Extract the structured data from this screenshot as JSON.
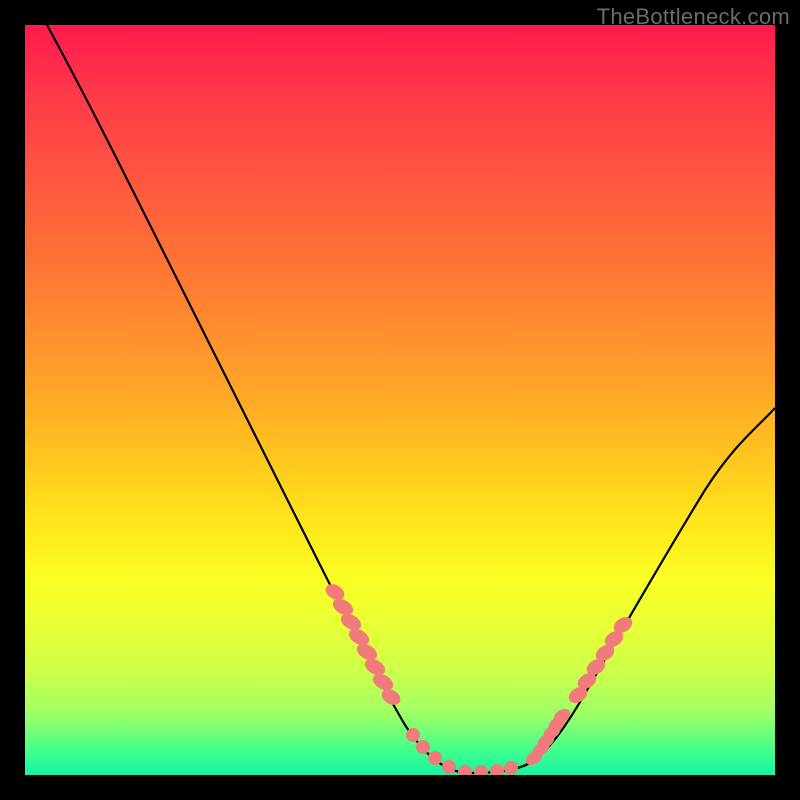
{
  "watermark": "TheBottleneck.com",
  "chart_data": {
    "type": "line",
    "title": "",
    "xlabel": "",
    "ylabel": "",
    "xlim": [
      0,
      100
    ],
    "ylim": [
      0,
      100
    ],
    "grid": false,
    "series": [
      {
        "name": "curve",
        "x": [
          3,
          8,
          12,
          18,
          24,
          30,
          36,
          41,
          47,
          50,
          53,
          56,
          60,
          63,
          66,
          68,
          71,
          74,
          78,
          82,
          86,
          90,
          94,
          100
        ],
        "y": [
          100,
          90,
          82,
          70,
          58,
          46,
          34,
          24,
          12,
          7,
          3,
          1,
          0,
          0,
          0,
          1,
          3,
          6,
          11,
          17,
          24,
          31,
          38,
          49
        ]
      }
    ],
    "highlights": [
      {
        "name": "left-cluster",
        "x_range": [
          41,
          49
        ],
        "y_range": [
          7,
          24
        ]
      },
      {
        "name": "valley-cluster",
        "x_range": [
          52,
          66
        ],
        "y_range": [
          0,
          3
        ]
      },
      {
        "name": "right-dense",
        "x_range": [
          67,
          72
        ],
        "y_range": [
          1,
          7
        ]
      },
      {
        "name": "right-cluster",
        "x_range": [
          73,
          80
        ],
        "y_range": [
          8,
          15
        ]
      }
    ],
    "colors": {
      "curve": "#000000",
      "highlight": "#f17a7a",
      "background_top": "#ff1a4d",
      "background_bottom": "#17f2a3"
    }
  }
}
